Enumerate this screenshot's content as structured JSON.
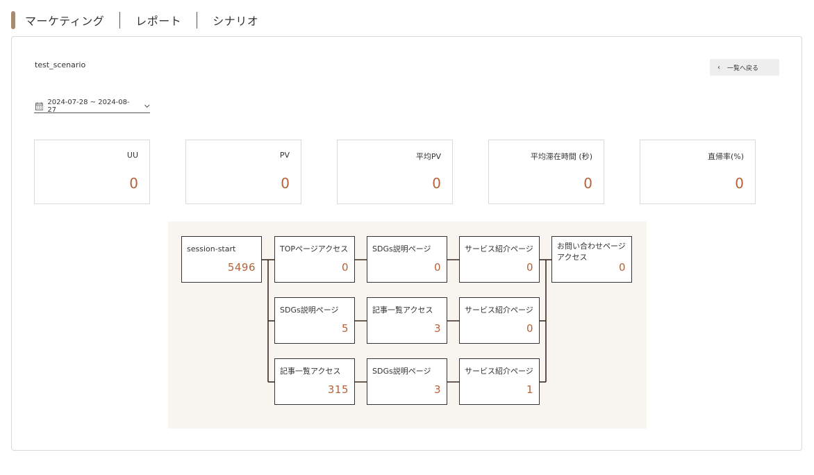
{
  "breadcrumb": [
    "マーケティング",
    "レポート",
    "シナリオ"
  ],
  "scenario_name": "test_scenario",
  "back_button": {
    "label": "一覧へ戻る"
  },
  "date_range": "2024-07-28 ~ 2024-08-27",
  "stats": [
    {
      "label": "UU",
      "value": "0"
    },
    {
      "label": "PV",
      "value": "0"
    },
    {
      "label": "平均PV",
      "value": "0"
    },
    {
      "label": "平均滞在時間 (秒)",
      "value": "0"
    },
    {
      "label": "直帰率(%)",
      "value": "0"
    }
  ],
  "flow": {
    "start": {
      "label": "session-start",
      "value": "5496"
    },
    "rows": [
      [
        {
          "label": "TOPページアクセス",
          "value": "0"
        },
        {
          "label": "SDGs説明ページ",
          "value": "0"
        },
        {
          "label": "サービス紹介ページ",
          "value": "0"
        }
      ],
      [
        {
          "label": "SDGs説明ページ",
          "value": "5"
        },
        {
          "label": "記事一覧アクセス",
          "value": "3"
        },
        {
          "label": "サービス紹介ページ",
          "value": "0"
        }
      ],
      [
        {
          "label": "記事一覧アクセス",
          "value": "315"
        },
        {
          "label": "SDGs説明ページ",
          "value": "3"
        },
        {
          "label": "サービス紹介ページ",
          "value": "1"
        }
      ]
    ],
    "end": {
      "label": "お問い合わせページアクセス",
      "value": "0"
    }
  },
  "colors": {
    "accent": "#a88b6e",
    "value": "#b5623a",
    "flow_bg": "#f8f5f1"
  },
  "icons": {
    "back": "chevron-left-icon",
    "date": "calendar-icon",
    "dropdown": "chevron-down-icon"
  }
}
